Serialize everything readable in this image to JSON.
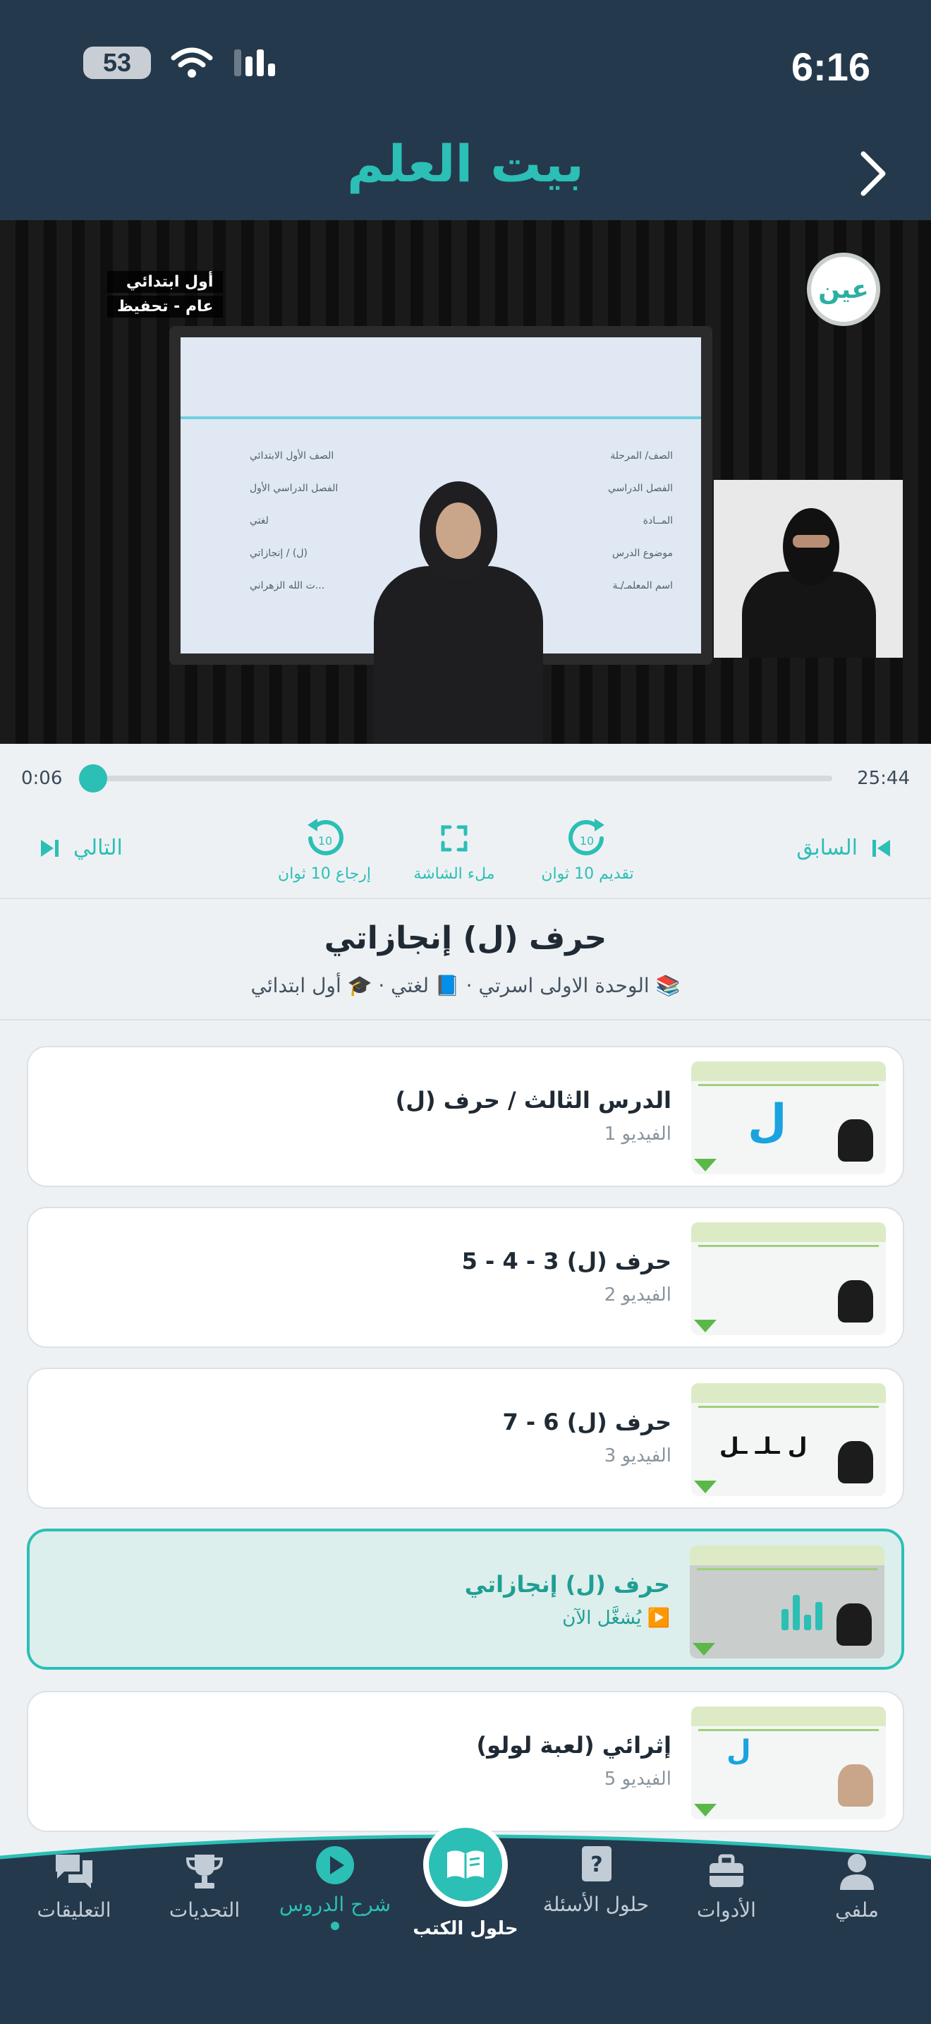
{
  "status_bar": {
    "time": "6:16",
    "battery": "53"
  },
  "header": {
    "title": "بيت العلم"
  },
  "video": {
    "logo_text": "عين",
    "grade_tag": [
      "أول ابتدائي",
      "عام - تحفيظ"
    ],
    "board_rows": [
      [
        "الصف/ المرحلة",
        "الصف الأول الابتدائي"
      ],
      [
        "الفصل الدراسي",
        "الفصل الدراسي الأول"
      ],
      [
        "المــادة",
        "لغتي"
      ],
      [
        "موضوع الدرس",
        "(ل) / إنجازاتي"
      ],
      [
        "اسم المعلمـ/ـة",
        "...ت الله الزهراني"
      ]
    ]
  },
  "player": {
    "elapsed": "0:06",
    "duration": "25:44",
    "progress_fraction": 0.004,
    "controls": {
      "previous": "السابق",
      "forward": "تقديم 10 ثوان",
      "fullscreen": "ملء الشاشة",
      "rewind": "إرجاع 10 ثوان",
      "next": "التالي",
      "seek_seconds": "10"
    }
  },
  "lesson": {
    "title": "حرف (ل) إنجازاتي",
    "meta": "📚 الوحدة الاولى اسرتي · 📘 لغتي · 🎓 أول ابتدائي"
  },
  "videos": [
    {
      "title": "الدرس الثالث / حرف (ل)",
      "subtitle": "الفيديو 1",
      "thumb_letter": "ل",
      "active": false
    },
    {
      "title": "حرف (ل) 3 - 4 - 5",
      "subtitle": "الفيديو 2",
      "thumb_letter": "",
      "active": false
    },
    {
      "title": "حرف (ل) 6 - 7",
      "subtitle": "الفيديو 3",
      "thumb_letter": "ل ـلـ ـل",
      "active": false
    },
    {
      "title": "حرف (ل) إنجازاتي",
      "subtitle": "▶️ يُشغَّل الآن",
      "thumb_letter": "",
      "active": true
    },
    {
      "title": "إثرائي (لعبة لولو)",
      "subtitle": "الفيديو 5",
      "thumb_letter": "ل",
      "active": false
    }
  ],
  "bottom_nav": {
    "items": [
      {
        "label": "ملفي",
        "icon": "person-icon"
      },
      {
        "label": "الأدوات",
        "icon": "briefcase-icon"
      },
      {
        "label": "حلول الأسئلة",
        "icon": "question-book-icon"
      },
      {
        "label": "حلول الكتب",
        "icon": "open-book-icon"
      },
      {
        "label": "شرح الدروس",
        "icon": "play-circle-icon"
      },
      {
        "label": "التحديات",
        "icon": "trophy-icon"
      },
      {
        "label": "التعليقات",
        "icon": "chat-icon"
      }
    ],
    "active": "شرح الدروس"
  },
  "colors": {
    "accent": "#2bbfb5",
    "header_bg": "#25394c",
    "nav_bg": "#25394c"
  }
}
